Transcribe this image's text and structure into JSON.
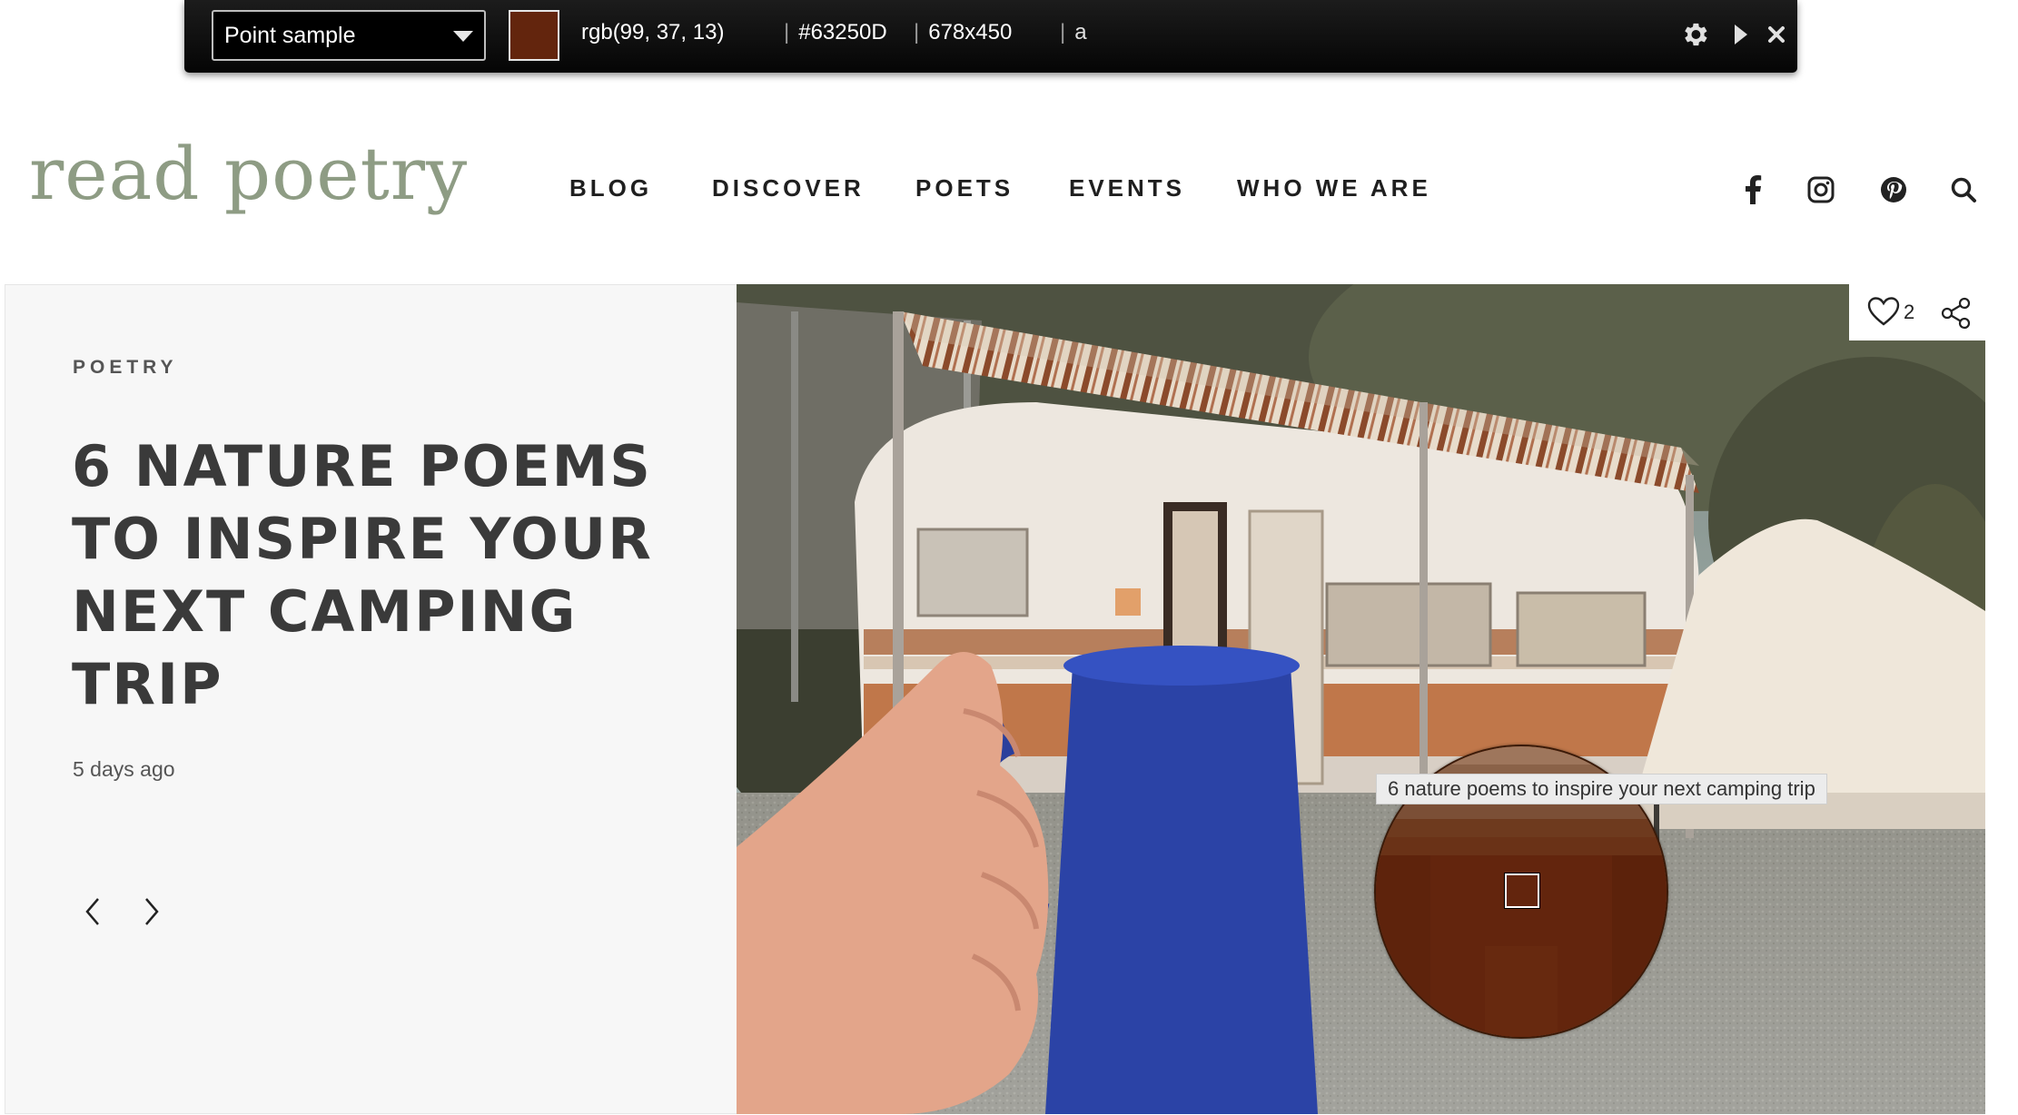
{
  "picker": {
    "mode_value": "Point sample",
    "color_rgb": "rgb(99, 37, 13)",
    "color_hex": "#63250D",
    "dimensions": "678x450",
    "alpha_label": "a",
    "swatch_color": "#63250D",
    "icons": [
      "gear-icon",
      "play-icon",
      "close-icon"
    ]
  },
  "site": {
    "logo": "read poetry",
    "logo_color": "#8e9c84",
    "nav": [
      "BLOG",
      "DISCOVER",
      "POETS",
      "EVENTS",
      "WHO WE ARE"
    ],
    "social_icons": [
      "facebook-icon",
      "instagram-icon",
      "pinterest-icon",
      "search-icon"
    ]
  },
  "hero": {
    "category": "POETRY",
    "title": "6 NATURE POEMS TO INSPIRE YOUR NEXT CAMPING TRIP",
    "date": "5 days ago",
    "like_count": "2",
    "image_tooltip": "6 nature poems to inspire your next camping trip"
  }
}
